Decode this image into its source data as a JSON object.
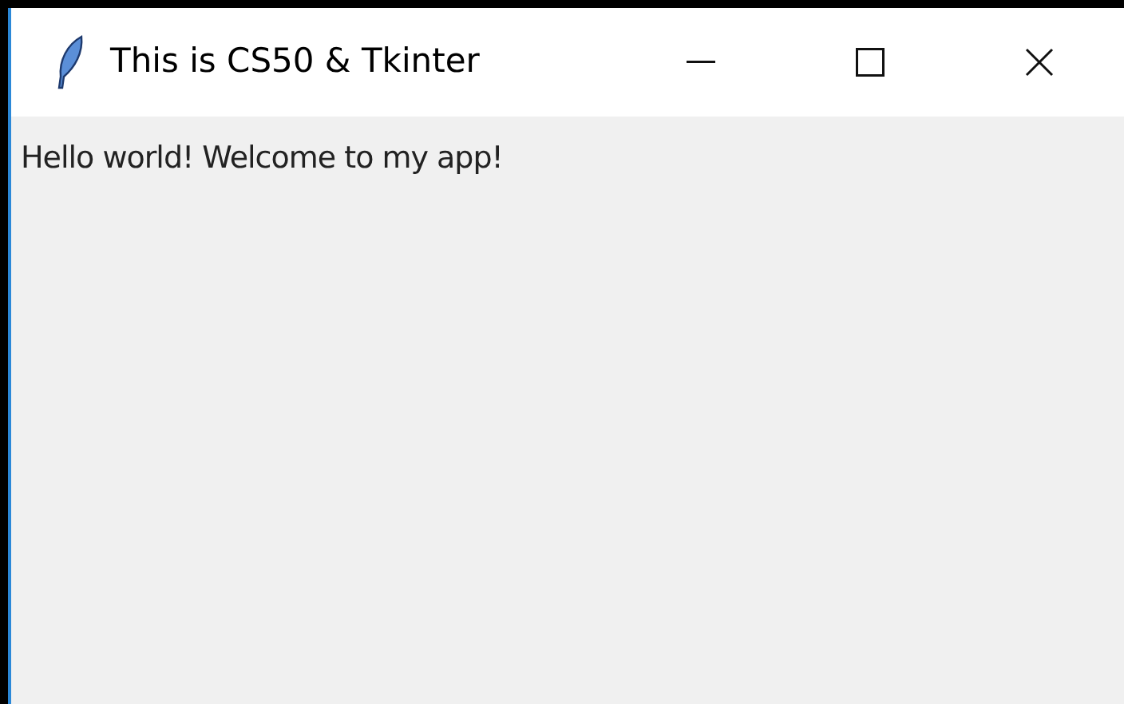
{
  "window": {
    "title": "This is CS50 & Tkinter"
  },
  "label": {
    "text": "Hello world! Welcome to my app!"
  }
}
